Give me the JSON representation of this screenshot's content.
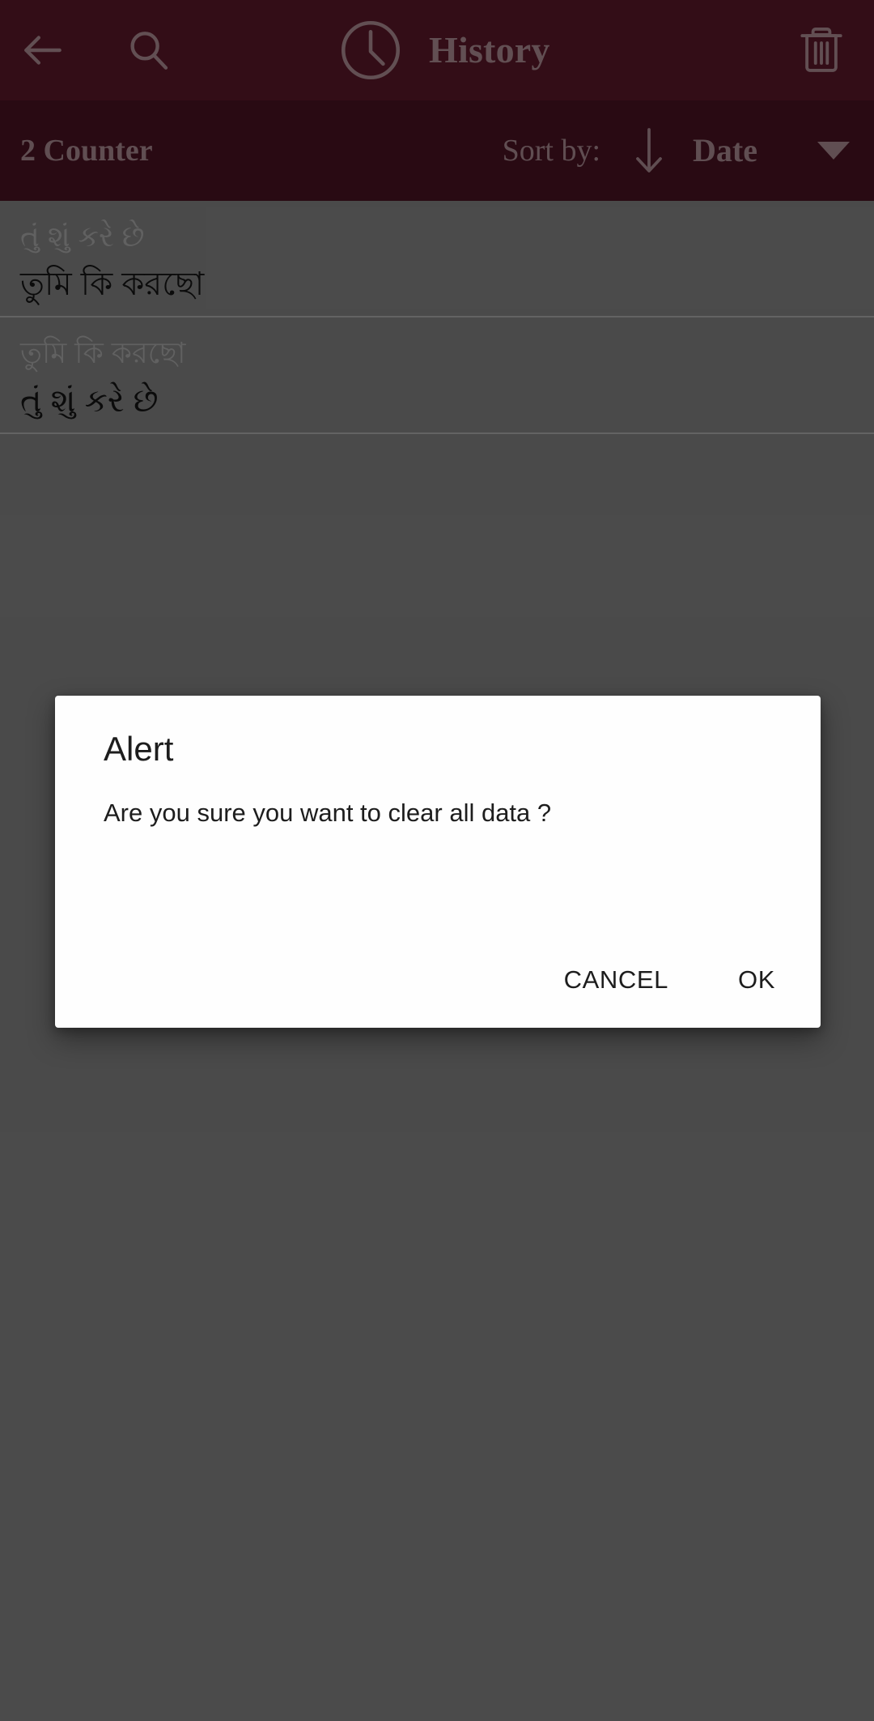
{
  "appbar": {
    "back_icon": "back-arrow-icon",
    "search_icon": "search-icon",
    "clock_icon": "clock-icon",
    "title": "History",
    "delete_icon": "trash-icon",
    "background_color": "#4a1322",
    "foreground_color": "#8d7177"
  },
  "sortbar": {
    "counter_label": "2 Counter",
    "sort_by_label": "Sort by:",
    "sort_direction_icon": "arrow-down-icon",
    "sort_value": "Date",
    "dropdown_icon": "caret-down-icon",
    "background_color": "#3b0f1c",
    "foreground_color": "#8a7076"
  },
  "history": {
    "items": [
      {
        "source_text": "તું શું કરે છે",
        "target_text": "তুমি কি করছো"
      },
      {
        "source_text": "তুমি কি করছো",
        "target_text": "તું શું કરે છે"
      }
    ]
  },
  "dialog": {
    "title": "Alert",
    "message": "Are you sure you want to clear all data ?",
    "cancel_label": "CANCEL",
    "ok_label": "OK",
    "background_color": "#fefefe",
    "text_color": "#1d1d1d"
  }
}
